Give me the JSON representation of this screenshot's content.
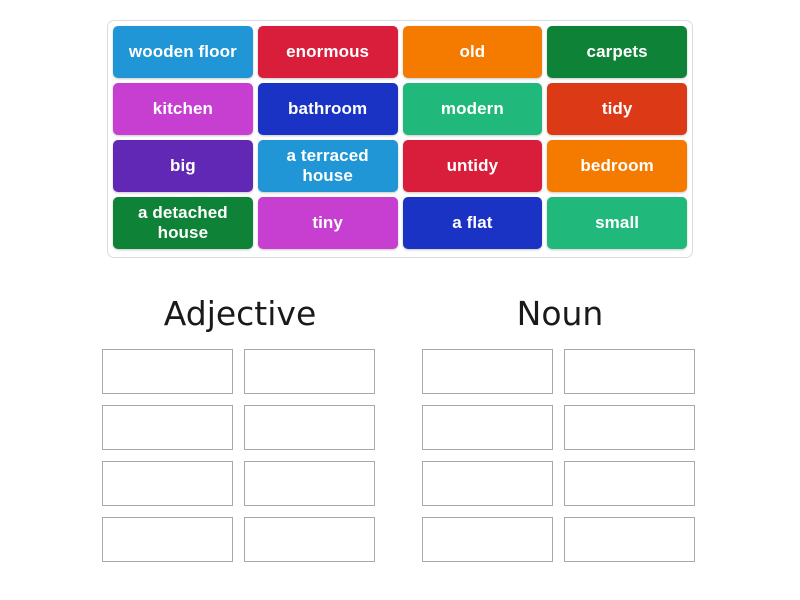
{
  "activity": {
    "type": "group-sort",
    "word_bank": {
      "name": "word-bank",
      "rows": [
        [
          {
            "label": "wooden floor",
            "color": "#2196d6"
          },
          {
            "label": "enormous",
            "color": "#d91e3c"
          },
          {
            "label": "old",
            "color": "#f47a00"
          },
          {
            "label": "carpets",
            "color": "#0e8237"
          }
        ],
        [
          {
            "label": "kitchen",
            "color": "#c63fd0"
          },
          {
            "label": "bathroom",
            "color": "#1a33c4"
          },
          {
            "label": "modern",
            "color": "#21b87c"
          },
          {
            "label": "tidy",
            "color": "#dc3a17"
          }
        ],
        [
          {
            "label": "big",
            "color": "#6128b5"
          },
          {
            "label": "a terraced house",
            "color": "#2196d6"
          },
          {
            "label": "untidy",
            "color": "#d91e3c"
          },
          {
            "label": "bedroom",
            "color": "#f47a00"
          }
        ],
        [
          {
            "label": "a detached house",
            "color": "#0e8237"
          },
          {
            "label": "tiny",
            "color": "#c63fd0"
          },
          {
            "label": "a flat",
            "color": "#1a33c4"
          },
          {
            "label": "small",
            "color": "#21b87c"
          }
        ]
      ]
    },
    "groups": [
      {
        "id": "adjective",
        "heading": "Adjective",
        "dropzones": [
          "",
          "",
          "",
          "",
          "",
          "",
          "",
          ""
        ]
      },
      {
        "id": "noun",
        "heading": "Noun",
        "dropzones": [
          "",
          "",
          "",
          "",
          "",
          "",
          "",
          ""
        ]
      }
    ]
  }
}
